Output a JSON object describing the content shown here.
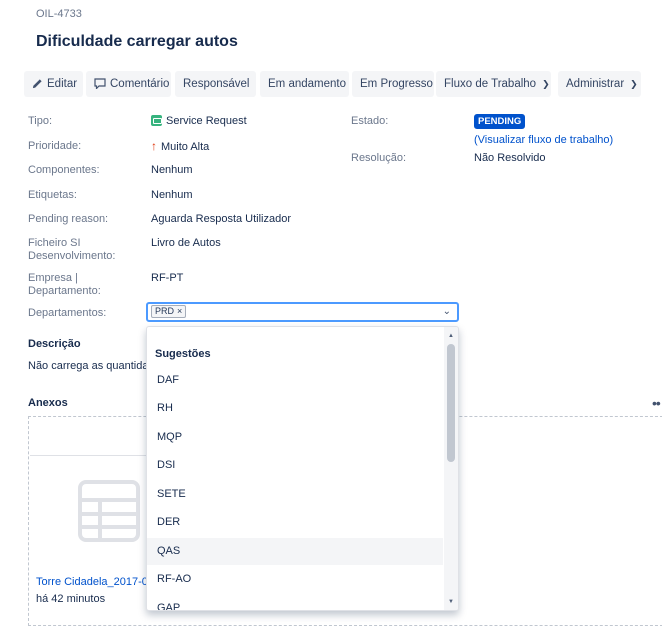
{
  "issue": {
    "key": "OIL-4733",
    "title": "Dificuldade carregar autos"
  },
  "toolbar": {
    "edit": "Editar",
    "comment": "Comentário",
    "assign": "Responsável",
    "in_progress_1": "Em andamento",
    "in_progress_2": "Em Progresso",
    "workflow": "Fluxo de Trabalho",
    "admin": "Administrar"
  },
  "details": {
    "type_label": "Tipo:",
    "type_value": "Service Request",
    "priority_label": "Prioridade:",
    "priority_value": "Muito Alta",
    "components_label": "Componentes:",
    "components_value": "Nenhum",
    "labels_label": "Etiquetas:",
    "labels_value": "Nenhum",
    "pending_label": "Pending reason:",
    "pending_value": "Aguarda Resposta Utilizador",
    "file_label_line1": "Ficheiro SI",
    "file_label_line2": "Desenvolvimento:",
    "file_value": "Livro de Autos",
    "company_label_line1": "Empresa |",
    "company_label_line2": "Departamento:",
    "company_value": "RF-PT",
    "departments_label": "Departamentos:",
    "departments_chip": "PRD"
  },
  "status": {
    "state_label": "Estado:",
    "state_value": "PENDING",
    "workflow_link": "(Visualizar fluxo de trabalho)",
    "resolution_label": "Resolução:",
    "resolution_value": "Não Resolvido",
    "accent_color": "#0052cc"
  },
  "description": {
    "title": "Descrição",
    "text": "Não carrega as quantida"
  },
  "attachments": {
    "title": "Anexos",
    "file_name": "Torre Cidadela_2017-0",
    "file_time": "há 42 minutos"
  },
  "dropdown": {
    "header": "Sugestões",
    "options": [
      "DAF",
      "RH",
      "MQP",
      "DSI",
      "SETE",
      "DER",
      "QAS",
      "RF-AO",
      "GAP"
    ],
    "hovered": "QAS"
  }
}
